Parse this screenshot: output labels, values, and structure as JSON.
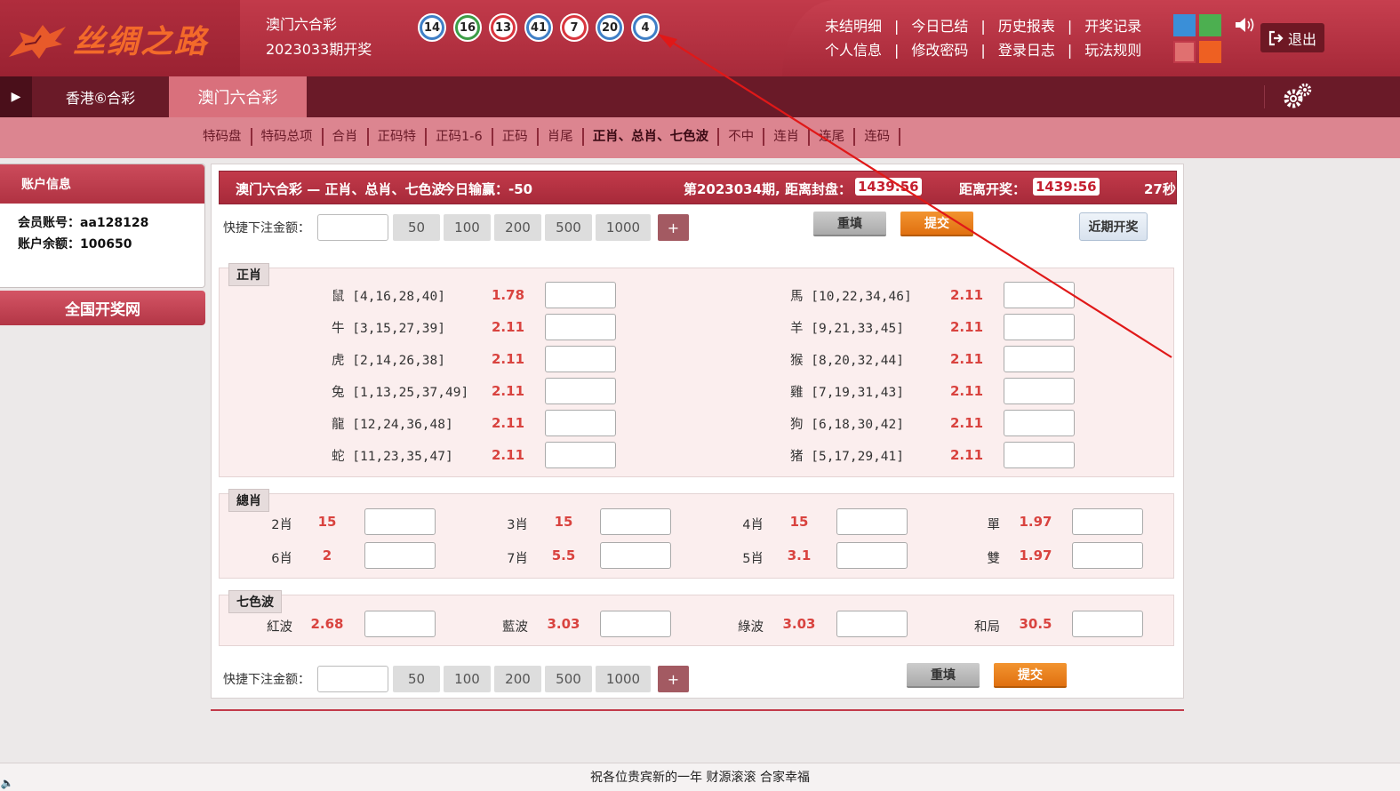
{
  "header": {
    "logo_text": "丝绸之路",
    "lottery_name": "澳门六合彩",
    "issue_text": "2023033期开奖",
    "balls": [
      {
        "num": "14",
        "color": "blue"
      },
      {
        "num": "16",
        "color": "green"
      },
      {
        "num": "13",
        "color": "red"
      },
      {
        "num": "41",
        "color": "blue"
      },
      {
        "num": "7",
        "color": "red"
      },
      {
        "num": "20",
        "color": "blue"
      },
      {
        "num": "4",
        "color": "blue"
      }
    ],
    "links_row1": [
      "未结明细",
      "今日已结",
      "历史报表",
      "开奖记录"
    ],
    "links_row2": [
      "个人信息",
      "修改密码",
      "登录日志",
      "玩法规则"
    ],
    "logout_label": "退出",
    "swatch_colors": [
      "#3a8fd8",
      "#4caf50",
      "#e07070",
      "#ee6022"
    ]
  },
  "tabs": {
    "items": [
      "香港⑥合彩",
      "澳门六合彩"
    ],
    "active": "澳门六合彩"
  },
  "subnav": {
    "items": [
      "特码盘",
      "特码总项",
      "合肖",
      "正码特",
      "正码1-6",
      "正码",
      "肖尾",
      "正肖、总肖、七色波",
      "不中",
      "连肖",
      "连尾",
      "连码"
    ],
    "active": "正肖、总肖、七色波"
  },
  "sidebar": {
    "title": "账户信息",
    "account_label": "会员账号：",
    "account_value": "aa128128",
    "balance_label": "账户余额：",
    "balance_value": "100650",
    "draw_link": "全国开奖网"
  },
  "main": {
    "title": "澳门六合彩 — 正肖、总肖、七色波",
    "winloss_label": "今日输赢：",
    "winloss_value": "-50",
    "issue_label": "第2023034期, 距离封盘：",
    "close_countdown": "1439:56",
    "open_label": "距离开奖：",
    "open_countdown": "1439:56",
    "seconds": "27秒",
    "quick_label": "快捷下注金额：",
    "quick_amounts": [
      "50",
      "100",
      "200",
      "500",
      "1000"
    ],
    "plus_label": "+",
    "reset_label": "重填",
    "submit_label": "提交",
    "recent_label": "近期开奖"
  },
  "zhengxiao": {
    "title": "正肖",
    "left": [
      {
        "name": "鼠 [4,16,28,40]",
        "odds": "1.78"
      },
      {
        "name": "牛 [3,15,27,39]",
        "odds": "2.11"
      },
      {
        "name": "虎 [2,14,26,38]",
        "odds": "2.11"
      },
      {
        "name": "兔 [1,13,25,37,49]",
        "odds": "2.11"
      },
      {
        "name": "龍 [12,24,36,48]",
        "odds": "2.11"
      },
      {
        "name": "蛇 [11,23,35,47]",
        "odds": "2.11"
      }
    ],
    "right": [
      {
        "name": "馬 [10,22,34,46]",
        "odds": "2.11"
      },
      {
        "name": "羊 [9,21,33,45]",
        "odds": "2.11"
      },
      {
        "name": "猴 [8,20,32,44]",
        "odds": "2.11"
      },
      {
        "name": "雞 [7,19,31,43]",
        "odds": "2.11"
      },
      {
        "name": "狗 [6,18,30,42]",
        "odds": "2.11"
      },
      {
        "name": "猪 [5,17,29,41]",
        "odds": "2.11"
      }
    ]
  },
  "zongxiao": {
    "title": "總肖",
    "row1": [
      {
        "name": "2肖",
        "odds": "15"
      },
      {
        "name": "3肖",
        "odds": "15"
      },
      {
        "name": "4肖",
        "odds": "15"
      },
      {
        "name": "單",
        "odds": "1.97"
      }
    ],
    "row2": [
      {
        "name": "6肖",
        "odds": "2"
      },
      {
        "name": "7肖",
        "odds": "5.5"
      },
      {
        "name": "5肖",
        "odds": "3.1"
      },
      {
        "name": "雙",
        "odds": "1.97"
      }
    ]
  },
  "qisebo": {
    "title": "七色波",
    "row": [
      {
        "name": "紅波",
        "odds": "2.68"
      },
      {
        "name": "藍波",
        "odds": "3.03"
      },
      {
        "name": "綠波",
        "odds": "3.03"
      },
      {
        "name": "和局",
        "odds": "30.5"
      }
    ]
  },
  "footer": {
    "text": "祝各位贵宾新的一年 财源滚滚 合家幸福"
  }
}
